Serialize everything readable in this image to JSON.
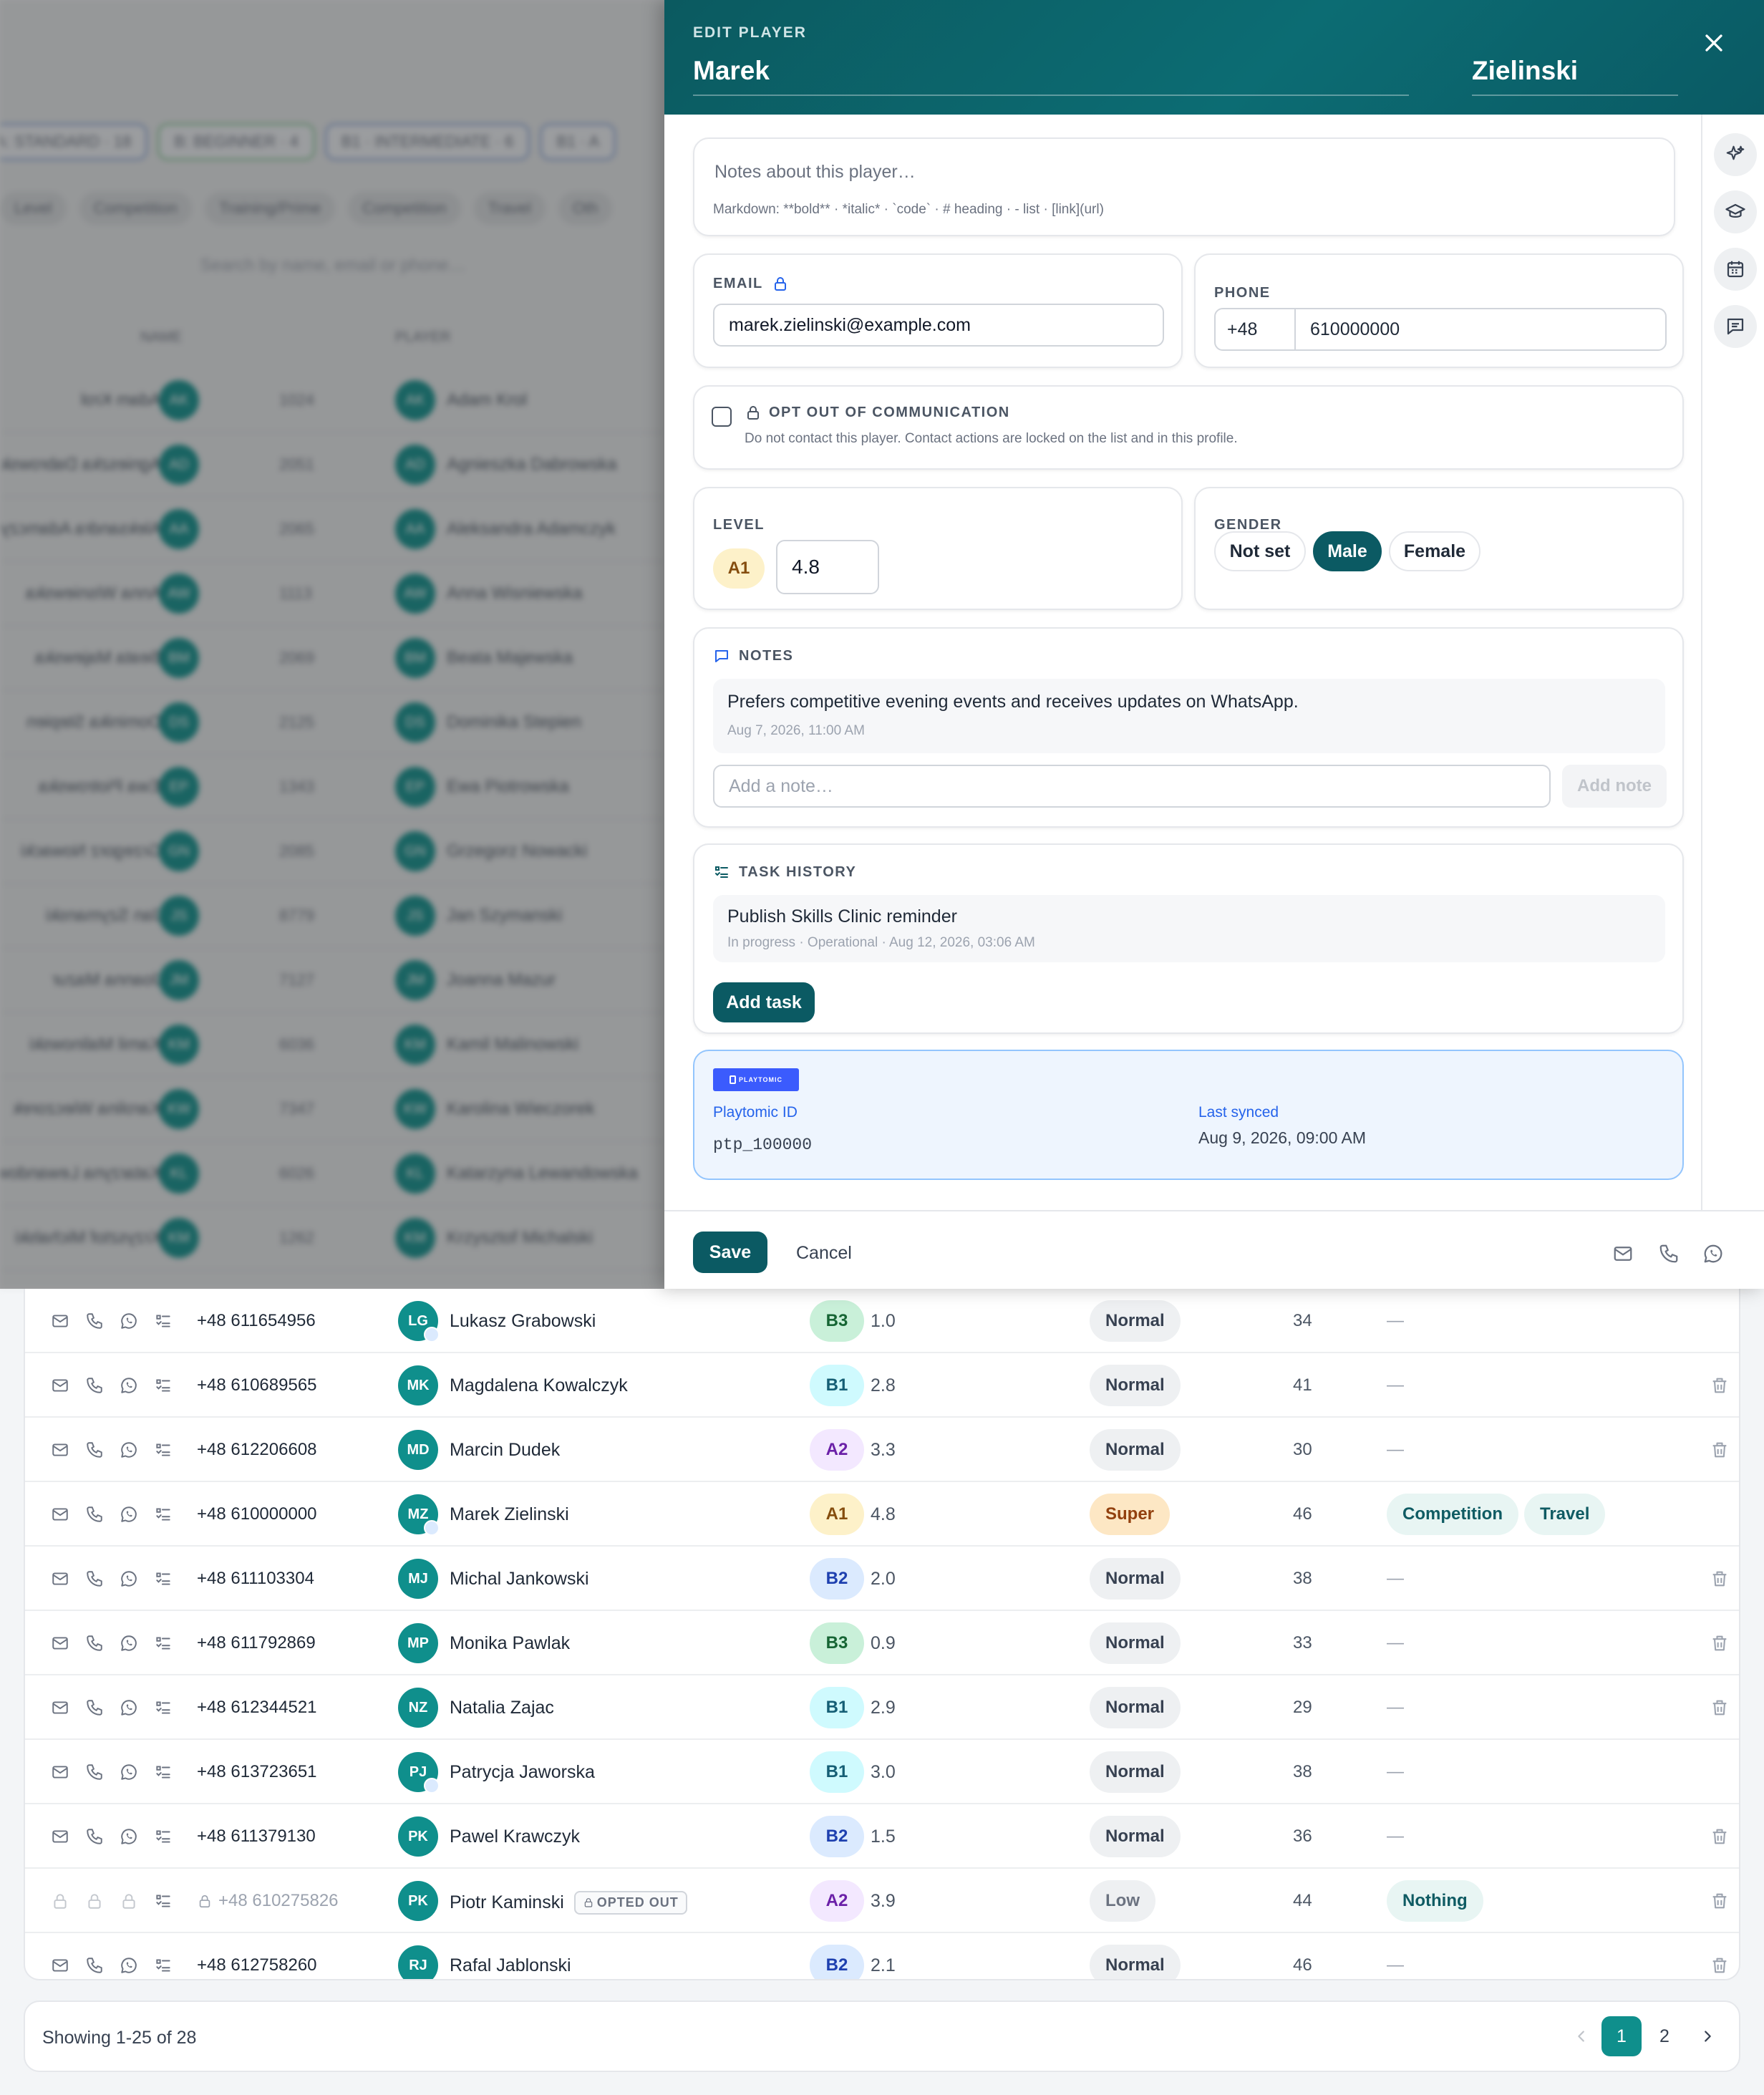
{
  "background": {
    "filter_chips": [
      "A: STANDARD · 18",
      "B: BEGINNER · 4",
      "B1 · INTERMEDIATE · 6",
      "B1 · A"
    ],
    "tabs": [
      "Level",
      "Competition",
      "Training/Prime",
      "Competition",
      "Travel",
      "Oth"
    ],
    "search_placeholder": "Search by name, email or phone…",
    "columns": [
      "NAME",
      "PLAYER"
    ],
    "rows": [
      {
        "initials": "AK",
        "num": "1024",
        "name": "Adam Krol"
      },
      {
        "initials": "AD",
        "num": "2051",
        "name": "Agnieszka Dabrowska"
      },
      {
        "initials": "AA",
        "num": "2065",
        "name": "Aleksandra Adamczyk"
      },
      {
        "initials": "AW",
        "num": "1113",
        "name": "Anna Wisniewska"
      },
      {
        "initials": "BM",
        "num": "2069",
        "name": "Beata Majewska"
      },
      {
        "initials": "DS",
        "num": "2125",
        "name": "Dominika Stepien"
      },
      {
        "initials": "EP",
        "num": "1343",
        "name": "Ewa Piotrowska"
      },
      {
        "initials": "GN",
        "num": "2085",
        "name": "Grzegorz Nowacki"
      },
      {
        "initials": "JS",
        "num": "8779",
        "name": "Jan Szymanski"
      },
      {
        "initials": "JM",
        "num": "7127",
        "name": "Joanna Mazur"
      },
      {
        "initials": "KM",
        "num": "6036",
        "name": "Kamil Malinowski"
      },
      {
        "initials": "KW",
        "num": "7347",
        "name": "Karolina Wieczorek"
      },
      {
        "initials": "KL",
        "num": "6026",
        "name": "Katarzyna Lewandowska"
      },
      {
        "initials": "KM",
        "num": "1262",
        "name": "Krzysztof Michalski"
      }
    ]
  },
  "table": {
    "rows": [
      {
        "phone": "+48 611654956",
        "initials": "LG",
        "synced": true,
        "name": "Lukasz Grabowski",
        "level": "B3",
        "score": "1.0",
        "priority": "Normal",
        "age": "34",
        "tags": [],
        "deletable": false,
        "opted_out": false
      },
      {
        "phone": "+48 610689565",
        "initials": "MK",
        "synced": false,
        "name": "Magdalena Kowalczyk",
        "level": "B1",
        "score": "2.8",
        "priority": "Normal",
        "age": "41",
        "tags": [],
        "deletable": true,
        "opted_out": false
      },
      {
        "phone": "+48 612206608",
        "initials": "MD",
        "synced": false,
        "name": "Marcin Dudek",
        "level": "A2",
        "score": "3.3",
        "priority": "Normal",
        "age": "30",
        "tags": [],
        "deletable": true,
        "opted_out": false
      },
      {
        "phone": "+48 610000000",
        "initials": "MZ",
        "synced": true,
        "name": "Marek Zielinski",
        "level": "A1",
        "score": "4.8",
        "priority": "Super",
        "age": "46",
        "tags": [
          "Competition",
          "Travel"
        ],
        "deletable": false,
        "opted_out": false
      },
      {
        "phone": "+48 611103304",
        "initials": "MJ",
        "synced": false,
        "name": "Michal Jankowski",
        "level": "B2",
        "score": "2.0",
        "priority": "Normal",
        "age": "38",
        "tags": [],
        "deletable": true,
        "opted_out": false
      },
      {
        "phone": "+48 611792869",
        "initials": "MP",
        "synced": false,
        "name": "Monika Pawlak",
        "level": "B3",
        "score": "0.9",
        "priority": "Normal",
        "age": "33",
        "tags": [],
        "deletable": true,
        "opted_out": false
      },
      {
        "phone": "+48 612344521",
        "initials": "NZ",
        "synced": false,
        "name": "Natalia Zajac",
        "level": "B1",
        "score": "2.9",
        "priority": "Normal",
        "age": "29",
        "tags": [],
        "deletable": true,
        "opted_out": false
      },
      {
        "phone": "+48 613723651",
        "initials": "PJ",
        "synced": true,
        "name": "Patrycja Jaworska",
        "level": "B1",
        "score": "3.0",
        "priority": "Normal",
        "age": "38",
        "tags": [],
        "deletable": false,
        "opted_out": false
      },
      {
        "phone": "+48 611379130",
        "initials": "PK",
        "synced": false,
        "name": "Pawel Krawczyk",
        "level": "B2",
        "score": "1.5",
        "priority": "Normal",
        "age": "36",
        "tags": [],
        "deletable": true,
        "opted_out": false
      },
      {
        "phone": "+48 610275826",
        "initials": "PK",
        "synced": false,
        "name": "Piotr Kaminski",
        "level": "A2",
        "score": "3.9",
        "priority": "Low",
        "age": "44",
        "tags": [
          "Nothing"
        ],
        "deletable": true,
        "opted_out": true
      },
      {
        "phone": "+48 612758260",
        "initials": "RJ",
        "synced": false,
        "name": "Rafal Jablonski",
        "level": "B2",
        "score": "2.1",
        "priority": "Normal",
        "age": "46",
        "tags": [],
        "deletable": true,
        "opted_out": false
      }
    ],
    "dash": "—",
    "opted_out_badge": "OPTED OUT"
  },
  "pagination": {
    "info": "Showing 1-25 of 28",
    "pages": [
      "1",
      "2"
    ],
    "current": "1"
  },
  "drawer": {
    "kicker": "EDIT PLAYER",
    "first_name": "Marek",
    "last_name": "Zielinski",
    "about_placeholder": "Notes about this player…",
    "markdown_hint": "Markdown: **bold** · *italic* · `code` · # heading · - list · [link](url)",
    "email_label": "EMAIL",
    "email_value": "marek.zielinski@example.com",
    "phone_label": "PHONE",
    "phone_prefix": "+48",
    "phone_value": "610000000",
    "optout_label": "OPT OUT OF COMMUNICATION",
    "optout_desc": "Do not contact this player. Contact actions are locked on the list and in this profile.",
    "level_label": "LEVEL",
    "level_badge": "A1",
    "level_value": "4.8",
    "gender_label": "GENDER",
    "gender_options": [
      "Not set",
      "Male",
      "Female"
    ],
    "gender_selected": "Male",
    "notes_label": "NOTES",
    "note_text": "Prefers competitive evening events and receives updates on WhatsApp.",
    "note_time": "Aug 7, 2026, 11:00 AM",
    "add_note_placeholder": "Add a note…",
    "add_note_button": "Add note",
    "tasks_label": "TASK HISTORY",
    "task_title": "Publish Skills Clinic reminder",
    "task_meta": "In progress · Operational · Aug 12, 2026, 03:06 AM",
    "add_task_button": "Add task",
    "playtomic_logo": "PLAYTOMIC",
    "playtomic_id_label": "Playtomic ID",
    "playtomic_id_value": "ptp_100000",
    "last_synced_label": "Last synced",
    "last_synced_value": "Aug 9, 2026, 09:00 AM",
    "save_button": "Save",
    "cancel_button": "Cancel"
  },
  "colors": {
    "brand": "#0b5a63",
    "avatar": "#0f8f8c",
    "playtomic_blue": "#3b5bfd"
  }
}
